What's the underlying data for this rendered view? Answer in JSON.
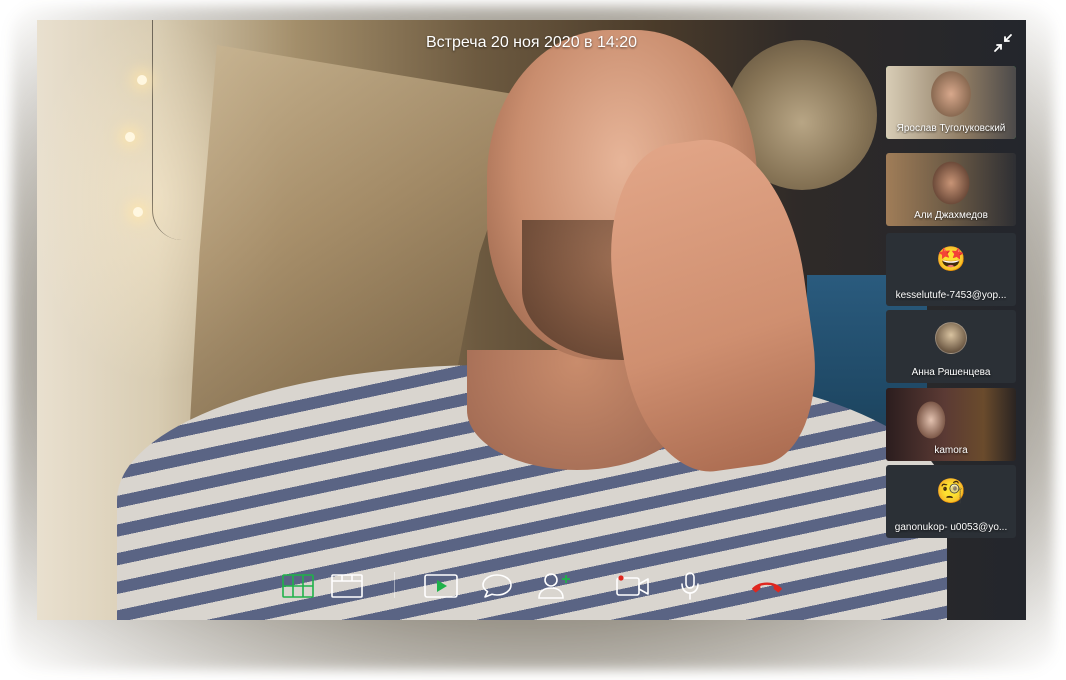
{
  "meeting": {
    "title": "Встреча 20 ноя 2020 в 14:20"
  },
  "header": {
    "collapse_icon": "collapse-arrows-icon"
  },
  "participants": [
    {
      "name": "Ярослав Туголуковский",
      "kind": "video",
      "active": true
    },
    {
      "name": "Али Джахмедов",
      "kind": "video",
      "active": false
    },
    {
      "name": "kesselutufe-7453@yop...",
      "kind": "emoji",
      "emoji": "🤩",
      "active": false
    },
    {
      "name": "Анна Ряшенцева",
      "kind": "avatar",
      "active": false
    },
    {
      "name": "kamora",
      "kind": "video",
      "active": false
    },
    {
      "name": "ganonukop- u0053@yo...",
      "kind": "emoji",
      "emoji": "🧐",
      "active": false
    }
  ],
  "toolbar": {
    "items": [
      {
        "name": "grid-view-icon",
        "color": "#1fb24a"
      },
      {
        "name": "speaker-view-icon",
        "color": "#ffffff"
      },
      {
        "name": "screen-share-play-icon",
        "color": "#1fb24a"
      },
      {
        "name": "chat-bubble-icon",
        "color": "#ffffff"
      },
      {
        "name": "add-participant-icon",
        "color": "#ffffff"
      },
      {
        "name": "camera-icon",
        "color": "#ffffff"
      },
      {
        "name": "microphone-icon",
        "color": "#ffffff"
      },
      {
        "name": "hang-up-icon",
        "color": "#e0271f"
      }
    ]
  },
  "colors": {
    "accent": "#1fb24a",
    "danger": "#e0271f",
    "tile_bg": "#2b3036",
    "text": "#ffffff"
  }
}
